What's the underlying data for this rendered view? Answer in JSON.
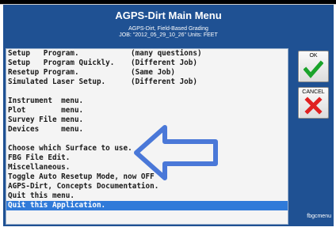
{
  "window": {
    "title": "AGPS-Dirt  Main Menu",
    "subtitle_line1": "AGPS-Dirt, Field-Based Grading",
    "subtitle_line2": "JOB: \"2012_05_29_10_26\"  Units: FEET",
    "corner_label": "fbgcmenu"
  },
  "buttons": {
    "ok_label": "OK",
    "cancel_label": "CANCEL",
    "ok_icon": "green-checkmark-icon",
    "cancel_icon": "red-x-icon"
  },
  "menu": {
    "items": [
      {
        "label": "Setup   Program.",
        "extra": "(many questions)"
      },
      {
        "label": "Setup   Program Quickly.",
        "extra": "(Different Job)"
      },
      {
        "label": "Resetup Program.",
        "extra": "(Same Job)"
      },
      {
        "label": "Simulated Laser Setup.",
        "extra": "(Different Job)"
      },
      {
        "label": "",
        "extra": ""
      },
      {
        "label": "Instrument  menu.",
        "extra": ""
      },
      {
        "label": "Plot        menu.",
        "extra": ""
      },
      {
        "label": "Survey File menu.",
        "extra": ""
      },
      {
        "label": "Devices     menu.",
        "extra": ""
      },
      {
        "label": "",
        "extra": ""
      },
      {
        "label": "Choose which Surface to use.",
        "extra": ""
      },
      {
        "label": "FBG File Edit.",
        "extra": ""
      },
      {
        "label": "Miscellaneous.",
        "extra": ""
      },
      {
        "label": "Toggle Auto Resetup Mode, now OFF",
        "extra": ""
      },
      {
        "label": "AGPS-Dirt, Concepts Documentation.",
        "extra": ""
      },
      {
        "label": "Quit this menu.",
        "extra": ""
      },
      {
        "label": "Quit this Application.",
        "extra": ""
      }
    ],
    "selected_index": 16
  },
  "overlay": {
    "arrow_icon": "left-arrow-icon",
    "arrow_color": "#4a78d8"
  },
  "colors": {
    "window_bg": "#1f5193",
    "selection_bg": "#2f7ad9",
    "ok_green": "#1aa32a",
    "cancel_red": "#e02020"
  }
}
